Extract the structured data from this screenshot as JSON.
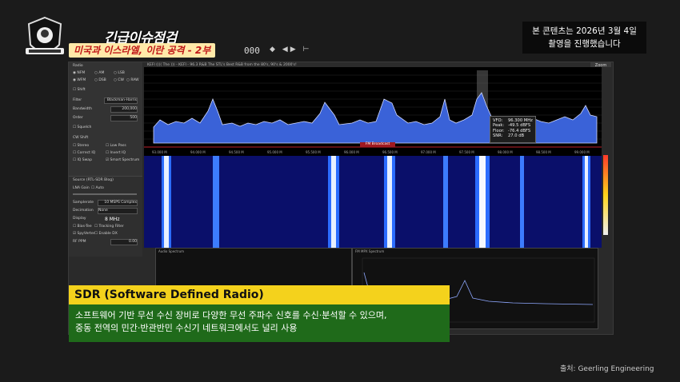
{
  "header": {
    "title_line1": "긴급이슈점검",
    "title_line2": "미국과 이스라엘, 이란 공격 - 2부",
    "notice_line1": "본 콘텐츠는 2026년 3월 4일",
    "notice_line2": "촬영을 진행했습니다"
  },
  "app": {
    "toolbar_value": "000",
    "toolbar_icons": "◆ ◀▶ ⊢",
    "station_text": "KEFI  (((( The          ))) - KEFI - 96.3 R&B The STL's Best R&B from the 80's, 90's & 2000's!",
    "zoom_label": "Zoom",
    "left_panel": {
      "radio_label": "Radio",
      "modes": [
        "NFM",
        "AM",
        "LSB",
        "WFM",
        "DSB",
        "CW",
        "RAW"
      ],
      "shift_label": "Shift",
      "filter_label": "Filter",
      "filter_value": "Blackman-Harris",
      "bandwidth_label": "Bandwidth",
      "bandwidth_value": "200,000",
      "order_label": "Order",
      "order_value": "500",
      "squelch_label": "Squelch",
      "cw_shift_label": "CW Shift",
      "stereo_label": "Stereo",
      "low_pass_label": "Low Pass",
      "correct_iq_label": "Correct IQ",
      "invert_iq_label": "Invert IQ",
      "iq_swap_label": "IQ Swap",
      "smart_spectrum_label": "Smart Spectrum"
    },
    "source_panel": {
      "title": "Source (RTL-SDR Blog)",
      "lna_gain_label": "LNA Gain",
      "auto_label": "Auto",
      "samplerate_label": "Samplerate",
      "samplerate_value": "10 MSPS Complex",
      "decimation_label": "Decimation",
      "decimation_value": "None",
      "display_label": "Display",
      "display_value": "8 MHz",
      "bias_tee_label": "Bias-Tee",
      "tracking_filter_label": "Tracking Filter",
      "spyverter_label": "SpyVerter",
      "enable_dx_label": "Enable DX",
      "ppm_label": "RF PPM",
      "ppm_value": "0.00"
    },
    "freq_labels": [
      "93.000 M",
      "94.000 M",
      "94.500 M",
      "95.000 M",
      "95.500 M",
      "96.000 M",
      "96.500 M",
      "97.000 M",
      "97.500 M",
      "98.000 M",
      "98.500 M",
      "99.000 M"
    ],
    "db_labels": [
      "-30",
      "-40",
      "-50",
      "-60",
      "-70",
      "-80",
      "-90",
      "-100",
      "-110",
      "-120",
      "-130"
    ],
    "fm_broadcast_label": "FM Broadcast",
    "subwindow_left_title": "Audio Spectrum",
    "subwindow_right_title": "FM MPX Spectrum",
    "tooltip": {
      "vfo_label": "VFO:",
      "vfo_value": "96.300 MHz",
      "peak_label": "Peak:",
      "peak_value": "-49.5 dBFS",
      "floor_label": "Floor:",
      "floor_value": "-76.4 dBFS",
      "snr_label": "SNR:",
      "snr_value": "27.0 dB"
    }
  },
  "caption": {
    "title": "SDR (Software Defined Radio)",
    "line1": "소프트웨어 기반 무선 수신 장비로 다양한 무선 주파수 신호를 수신·분석할 수 있으며,",
    "line2": "중동 전역의 민간·반관반민 수신기 네트워크에서도 널리 사용"
  },
  "source_credit": "출처: Geerling Engineering",
  "colors": {
    "caption_title_bg": "#f4d21c",
    "caption_body_bg": "#1f6a1a",
    "spectrum_fill": "#3a62d8",
    "waterfall_bg": "#0a0f6a",
    "title_highlight": "#ffe9a8"
  }
}
